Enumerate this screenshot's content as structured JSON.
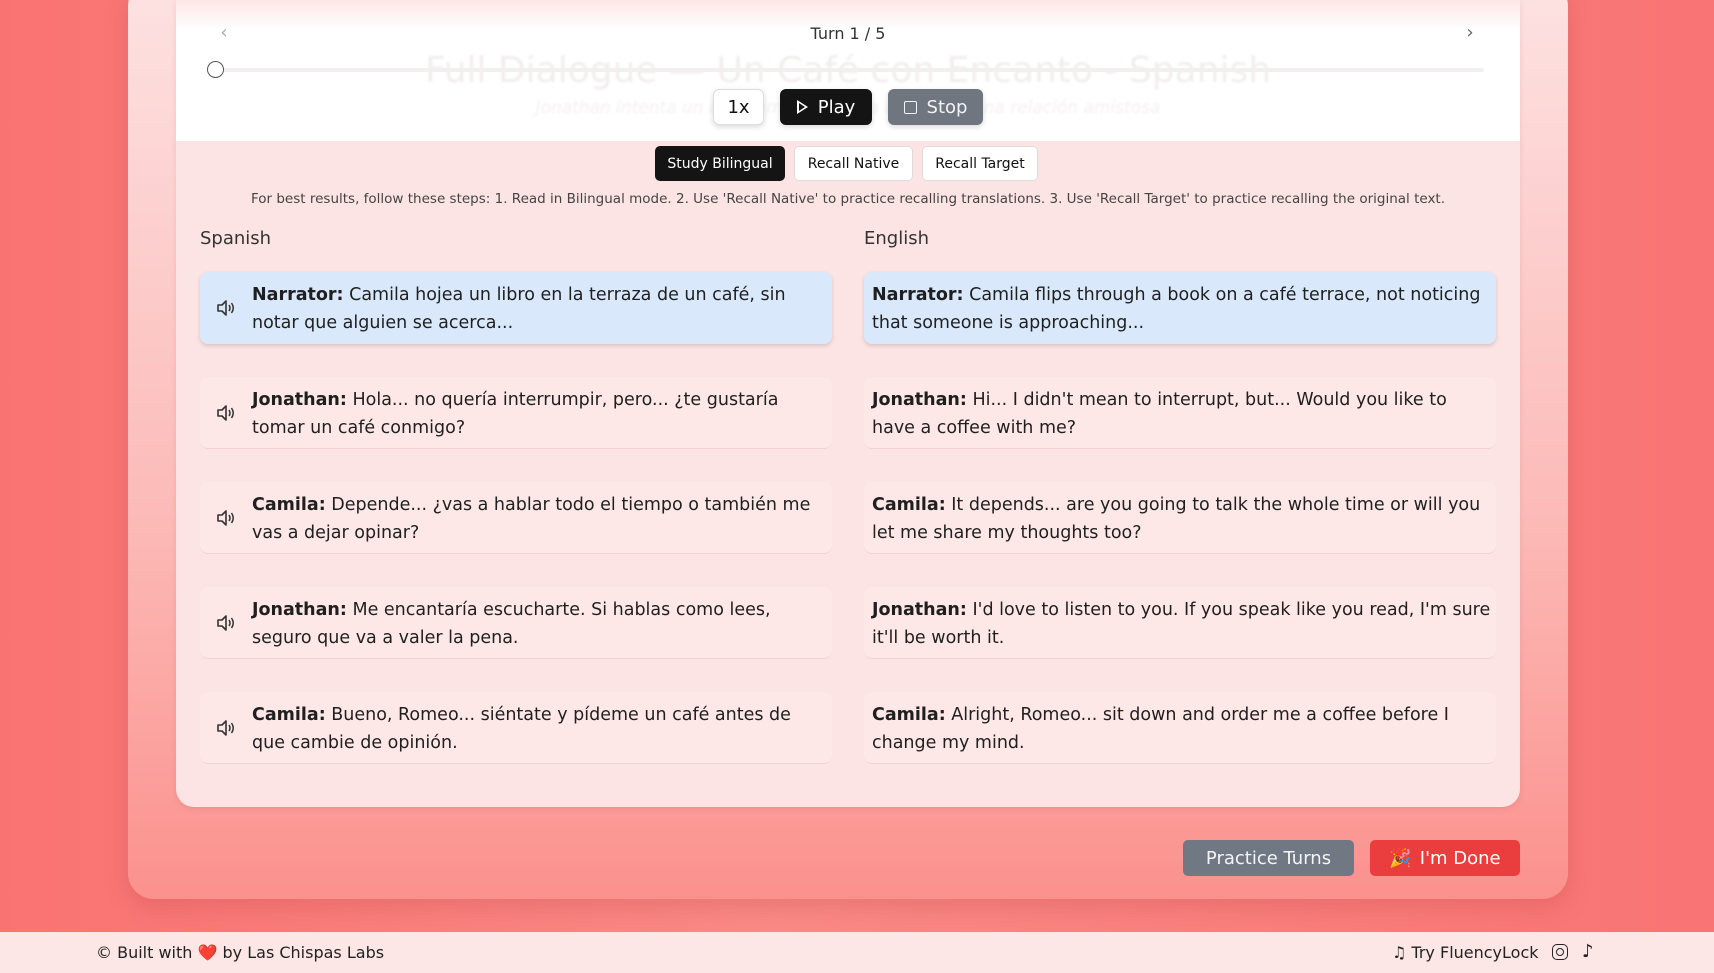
{
  "player": {
    "turn_label": "Turn 1 / 5",
    "title": "Full Dialogue — Un Café con Encanto - Spanish",
    "subtitle": "Jonathan intenta un acercamiento... una química y una relación amistosa",
    "prev_icon": "chevron-left-icon",
    "next_icon": "chevron-right-icon",
    "progress": 0,
    "speed_label": "1x",
    "play_label": "Play",
    "stop_label": "Stop"
  },
  "modes": {
    "study_bilingual": "Study Bilingual",
    "recall_native": "Recall Native",
    "recall_target": "Recall Target",
    "active": "Study Bilingual"
  },
  "hint": "For best results, follow these steps: 1. Read in Bilingual mode. 2. Use 'Recall Native' to practice recalling translations. 3. Use 'Recall Target' to practice recalling the original text.",
  "columns": {
    "target_heading": "Spanish",
    "native_heading": "English"
  },
  "dialogue": [
    {
      "es_speaker": "Narrator:",
      "es_text": " Camila hojea un libro en la terraza de un café, sin notar que alguien se acerca...",
      "en_speaker": "Narrator:",
      "en_text": " Camila flips through a book on a café terrace, not noticing that someone is approaching..."
    },
    {
      "es_speaker": "Jonathan:",
      "es_text": " Hola... no quería interrumpir, pero... ¿te gustaría tomar un café conmigo?",
      "en_speaker": "Jonathan:",
      "en_text": " Hi... I didn't mean to interrupt, but... Would you like to have a coffee with me?"
    },
    {
      "es_speaker": "Camila:",
      "es_text": " Depende... ¿vas a hablar todo el tiempo o también me vas a dejar opinar?",
      "en_speaker": "Camila:",
      "en_text": " It depends... are you going to talk the whole time or will you let me share my thoughts too?"
    },
    {
      "es_speaker": "Jonathan:",
      "es_text": " Me encantaría escucharte. Si hablas como lees, seguro que va a valer la pena.",
      "en_speaker": "Jonathan:",
      "en_text": " I'd love to listen to you. If you speak like you read, I'm sure it'll be worth it."
    },
    {
      "es_speaker": "Camila:",
      "es_text": " Bueno, Romeo... siéntate y pídeme un café antes de que cambie de opinión.",
      "en_speaker": "Camila:",
      "en_text": " Alright, Romeo... sit down and order me a coffee before I change my mind."
    }
  ],
  "actions": {
    "practice_label": "Practice Turns",
    "done_emoji": "🎉",
    "done_label": "I'm Done"
  },
  "footer": {
    "built_prefix": "© Built with",
    "heart": "❤️",
    "built_suffix": "by Las Chispas Labs",
    "fluency_link": "♫ Try FluencyLock",
    "instagram_icon": "instagram-icon",
    "tiktok_icon": "tiktok-icon"
  },
  "colors": {
    "background": "#f97372",
    "active_row": "#d9e9fb",
    "done_button": "#ea3e3e",
    "practice_button": "#6f7883"
  }
}
